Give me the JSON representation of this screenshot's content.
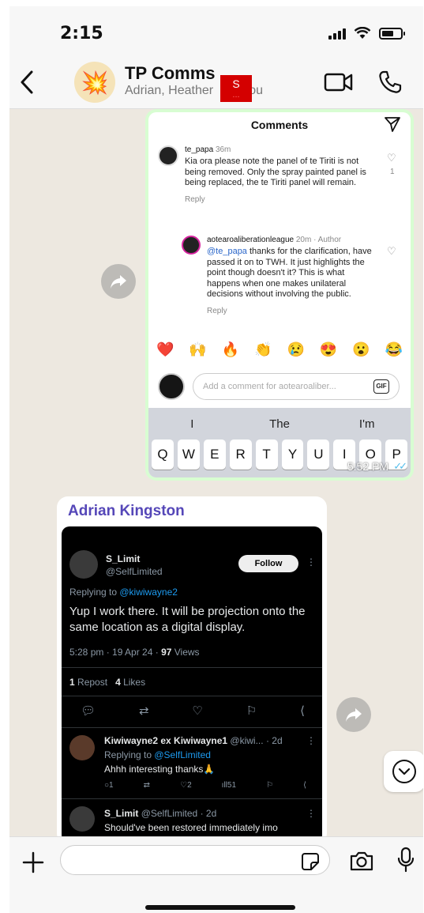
{
  "status_bar": {
    "time": "2:15"
  },
  "header": {
    "title": "TP Comms",
    "members": "Adrian, Heather",
    "members_tail": "You",
    "badge_text": "S",
    "badge_sub": "..."
  },
  "outgoing_message": {
    "time": "5:52 PM",
    "ticks": "✓✓",
    "screenshot": {
      "header": "Comments",
      "comment1": {
        "user": "te_papa",
        "age": "36m",
        "text": "Kia ora please note the panel of te Tiriti is not being removed. Only the spray painted panel is being replaced, the te Tiriti panel will remain.",
        "reply": "Reply",
        "likes": "1"
      },
      "comment2": {
        "user": "aotearoaliberationleague",
        "age": "20m · Author",
        "mention": "@te_papa",
        "text": " thanks for the clarification, have passed it on to TWH. It just highlights the point though doesn't it? This is what happens when one makes unilateral decisions without involving the public.",
        "reply": "Reply"
      },
      "emojis": [
        "❤️",
        "🙌",
        "🔥",
        "👏",
        "😢",
        "😍",
        "😮",
        "😂"
      ],
      "input_placeholder": "Add a comment for aotearoaliber...",
      "gif_label": "GIF",
      "suggestions": [
        "I",
        "The",
        "I'm"
      ],
      "keys": [
        "Q",
        "W",
        "E",
        "R",
        "T",
        "Y",
        "U",
        "I",
        "O",
        "P"
      ]
    }
  },
  "incoming_message": {
    "sender": "Adrian Kingston",
    "screenshot": {
      "tweet": {
        "name": "S_Limit",
        "handle": "@SelfLimited",
        "follow_label": "Follow",
        "replying_prefix": "Replying to ",
        "replying_to": "@kiwiwayne2",
        "body": "Yup I work there. It will be projection onto the same location as a digital display.",
        "time": "5:28 pm · 19 Apr 24 · ",
        "views_count": "97",
        "views_label": " Views",
        "reposts_count": "1",
        "reposts_label": " Repost",
        "likes_count": "4",
        "likes_label": " Likes"
      },
      "reply1": {
        "name": "Kiwiwayne2 ex Kiwiwayne1",
        "handle": "@kiwi...",
        "age": "· 2d",
        "replying_prefix": "Replying to ",
        "replying_to": "@SelfLimited",
        "text": "Ahhh interesting thanks🙏",
        "reply_count": "1",
        "like_count": "2",
        "view_count": "51"
      },
      "reply2": {
        "name": "S_Limit",
        "handle": "@SelfLimited",
        "age": "· 2d",
        "text": "Should've been restored immediately imo"
      }
    }
  },
  "composer": {
    "placeholder": ""
  },
  "colors": {
    "outgoing_bubble": "#d8fdd2",
    "chat_bg": "#ede8e0",
    "sender_name": "#5547b8",
    "tick_blue": "#53bdeb",
    "x_blue": "#1d9bf0"
  }
}
